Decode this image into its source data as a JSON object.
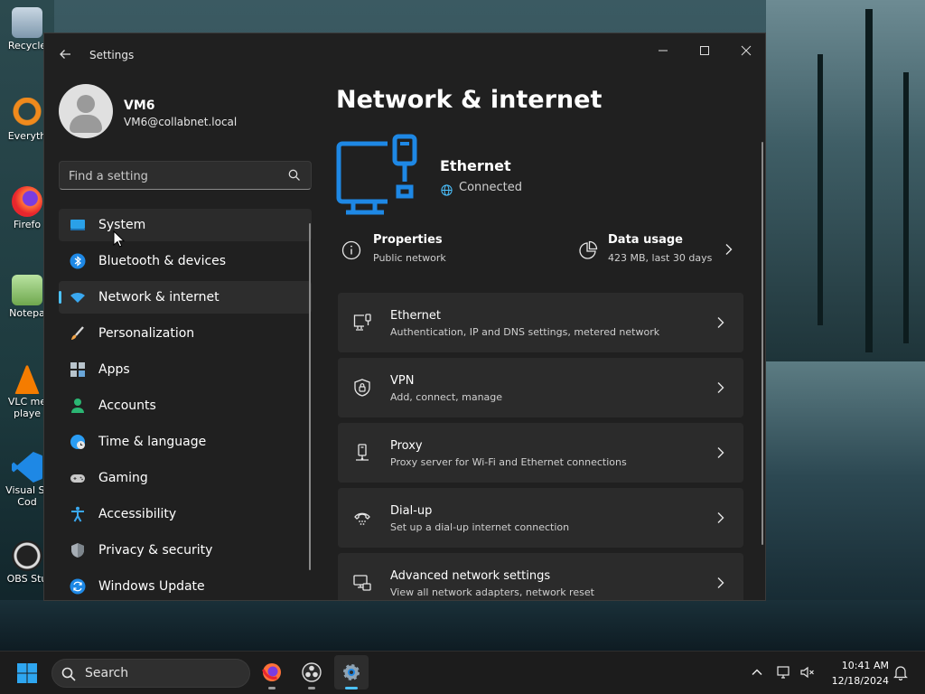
{
  "desktop": {
    "icons": [
      {
        "label": "Recycle"
      },
      {
        "label": "Everyth"
      },
      {
        "label": "Firefo"
      },
      {
        "label": "Notepa"
      },
      {
        "label": "VLC me",
        "label2": "playe"
      },
      {
        "label": "Visual St",
        "label2": "Cod"
      },
      {
        "label": "OBS Stu"
      }
    ]
  },
  "window": {
    "title": "Settings",
    "controls": {
      "minimize": "minimize-icon",
      "maximize": "maximize-icon",
      "close": "close-icon"
    }
  },
  "profile": {
    "name": "VM6",
    "email": "VM6@collabnet.local"
  },
  "search": {
    "placeholder": "Find a setting"
  },
  "sidebar": {
    "items": [
      {
        "label": "System",
        "icon": "system-icon"
      },
      {
        "label": "Bluetooth & devices",
        "icon": "bluetooth-icon"
      },
      {
        "label": "Network & internet",
        "icon": "wifi-icon",
        "selected": true
      },
      {
        "label": "Personalization",
        "icon": "brush-icon"
      },
      {
        "label": "Apps",
        "icon": "apps-icon"
      },
      {
        "label": "Accounts",
        "icon": "account-icon"
      },
      {
        "label": "Time & language",
        "icon": "globe-clock-icon"
      },
      {
        "label": "Gaming",
        "icon": "gamepad-icon"
      },
      {
        "label": "Accessibility",
        "icon": "accessibility-icon"
      },
      {
        "label": "Privacy & security",
        "icon": "shield-icon"
      },
      {
        "label": "Windows Update",
        "icon": "update-icon"
      }
    ]
  },
  "main": {
    "title": "Network & internet",
    "connection": {
      "name": "Ethernet",
      "status": "Connected"
    },
    "properties": {
      "title": "Properties",
      "subtitle": "Public network"
    },
    "data_usage": {
      "title": "Data usage",
      "subtitle": "423 MB, last 30 days"
    },
    "cards": [
      {
        "title": "Ethernet",
        "subtitle": "Authentication, IP and DNS settings, metered network",
        "icon": "ethernet-icon"
      },
      {
        "title": "VPN",
        "subtitle": "Add, connect, manage",
        "icon": "vpn-shield-icon"
      },
      {
        "title": "Proxy",
        "subtitle": "Proxy server for Wi-Fi and Ethernet connections",
        "icon": "proxy-icon"
      },
      {
        "title": "Dial-up",
        "subtitle": "Set up a dial-up internet connection",
        "icon": "dialup-icon"
      },
      {
        "title": "Advanced network settings",
        "subtitle": "View all network adapters, network reset",
        "icon": "advanced-network-icon"
      }
    ]
  },
  "taskbar": {
    "search_label": "Search",
    "time": "10:41 AM",
    "date": "12/18/2024"
  },
  "colors": {
    "accent": "#4cc2ff",
    "window_bg": "#202020",
    "card_bg": "#2b2b2b",
    "icon_blue": "#1e88e5"
  }
}
